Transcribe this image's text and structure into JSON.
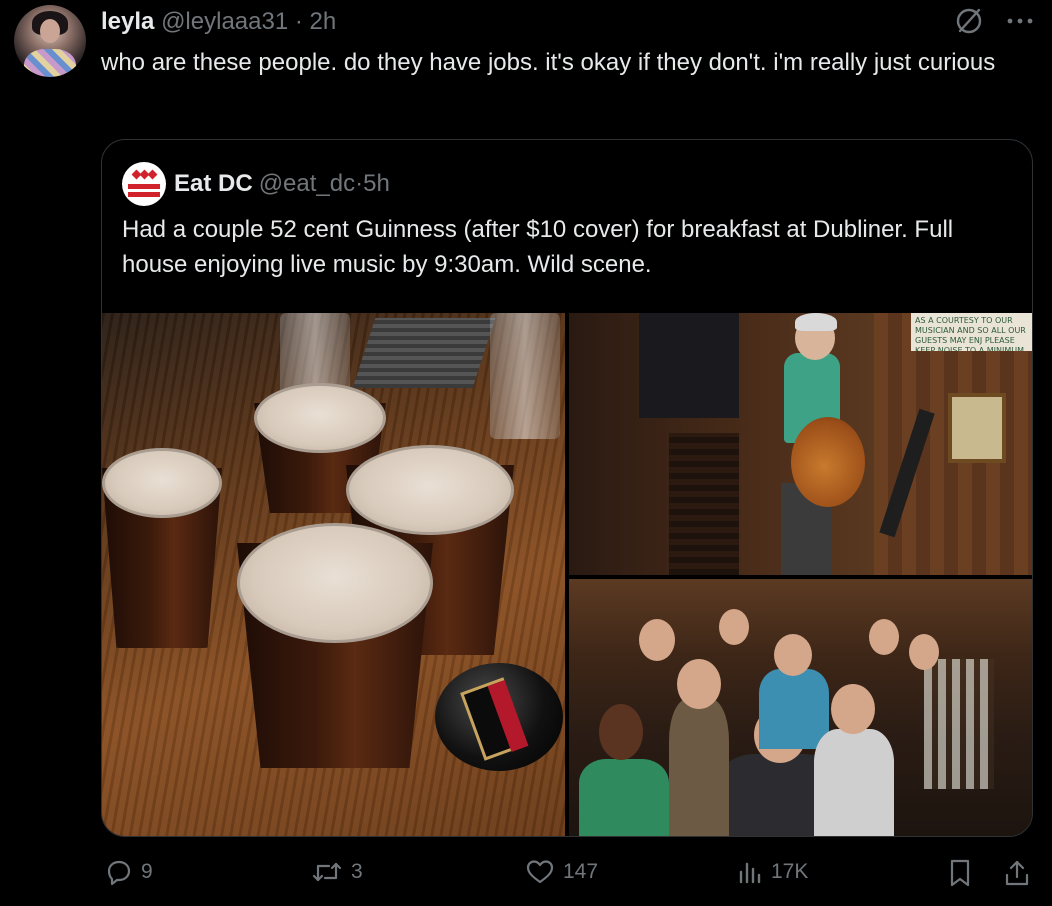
{
  "author": {
    "name": "leyla",
    "handle": "@leylaaa31",
    "separator": "·",
    "time": "2h"
  },
  "tweet_text": "who are these people. do they have jobs. it's okay if they don't. i'm really just curious",
  "quoted": {
    "name": "Eat DC",
    "handle": "@eat_dc",
    "separator": "·",
    "time": "5h",
    "text": "Had a couple 52 cent Guinness (after $10 cover) for breakfast at Dubliner. Full house enjoying live music by 9:30am. Wild scene.",
    "photo_sign_text": "AS A COURTESY TO OUR MUSICIAN AND SO ALL OUR GUESTS MAY ENJ PLEASE KEEP NOISE TO A MINIMUM DURING PERFO"
  },
  "actions": {
    "replies": "9",
    "reposts": "3",
    "likes": "147",
    "views": "17K"
  },
  "icons": {
    "grok": "grok-icon",
    "more": "more-icon",
    "reply": "reply-icon",
    "repost": "repost-icon",
    "like": "heart-icon",
    "views": "views-icon",
    "bookmark": "bookmark-icon",
    "share": "share-icon"
  },
  "colors": {
    "background": "#000000",
    "text": "#e7e9ea",
    "secondary": "#71767b",
    "border": "#2f3336"
  }
}
